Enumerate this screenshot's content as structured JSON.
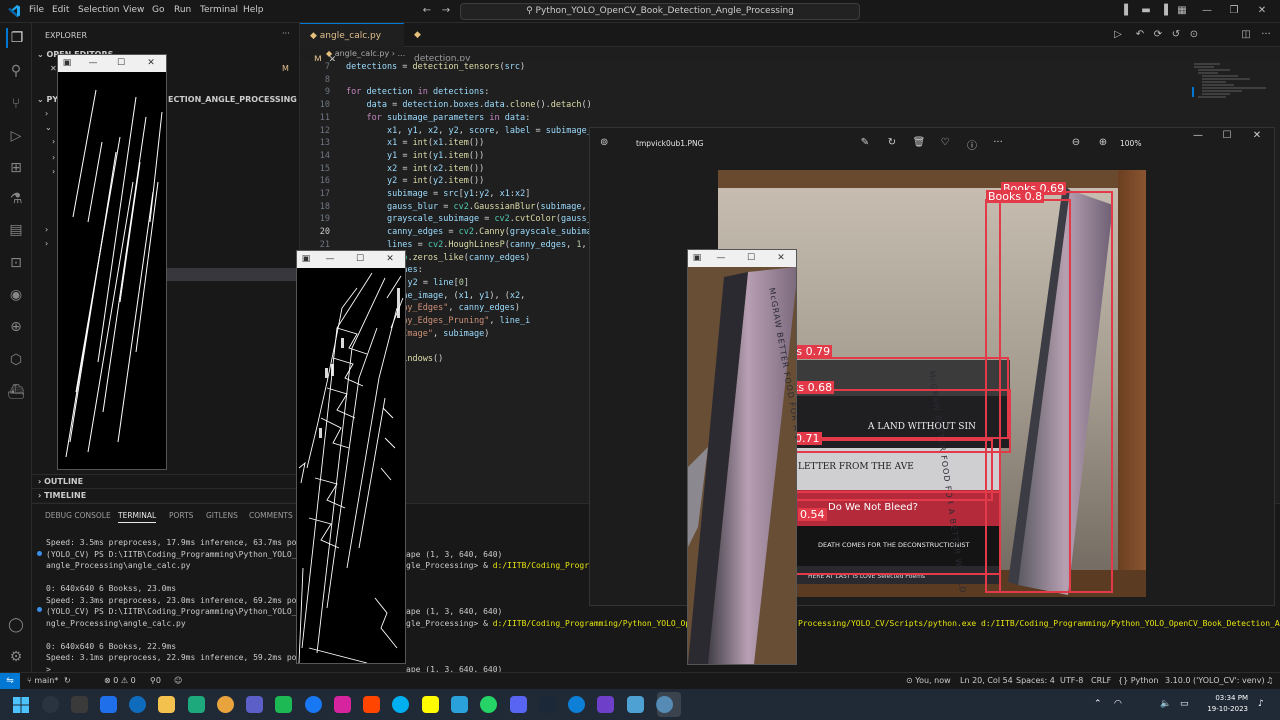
{
  "window": {
    "menu": [
      "File",
      "Edit",
      "Selection",
      "View",
      "Go",
      "Run",
      "Terminal",
      "Help"
    ],
    "search": "Python_YOLO_OpenCV_Book_Detection_Angle_Processing"
  },
  "sidebar": {
    "title": "EXPLORER",
    "open_editors": "OPEN EDITORS",
    "folder": "PYTHON_YOLO_OPENCV_BOOK_DETECTION_ANGLE_PROCESSING",
    "folder_visible": "ECTION_ANGLE_PROCESSING",
    "modified_marker": "M",
    "outline": "OUTLINE",
    "timeline": "TIMELINE"
  },
  "editor": {
    "tabs": [
      {
        "label": "angle_calc.py",
        "badge": "M"
      },
      {
        "label": "detection.py"
      }
    ],
    "breadcrumb": "angle_calc.py",
    "breadcrumb_more": "...",
    "current_line": 20
  },
  "code": [
    {
      "n": "7",
      "text": "detections = detection_tensors(src)"
    },
    {
      "n": "8",
      "text": ""
    },
    {
      "n": "9",
      "text": "for detection in detections:"
    },
    {
      "n": "10",
      "text": "    data = detection.boxes.data.clone().detach()"
    },
    {
      "n": "11",
      "text": "    for subimage_parameters in data:"
    },
    {
      "n": "12",
      "text": "        x1, y1, x2, y2, score, label = subimage_"
    },
    {
      "n": "13",
      "text": "        x1 = int(x1.item())"
    },
    {
      "n": "14",
      "text": "        y1 = int(y1.item())"
    },
    {
      "n": "15",
      "text": "        x2 = int(x2.item())"
    },
    {
      "n": "16",
      "text": "        y2 = int(y2.item())"
    },
    {
      "n": "17",
      "text": "        subimage = src[y1:y2, x1:x2]"
    },
    {
      "n": "18",
      "text": "        gauss_blur = cv2.GaussianBlur(subimage,"
    },
    {
      "n": "19",
      "text": "        grayscale_subimage = cv2.cvtColor(gauss_"
    },
    {
      "n": "20",
      "text": "        canny_edges = cv2.Canny(grayscale_subima"
    },
    {
      "n": "21",
      "text": "        lines = cv2.HoughLinesP(canny_edges, 1,"
    },
    {
      "n": "22",
      "text": "e_image = np.zeros_like(canny_edges)"
    },
    {
      "n": "23",
      "text": " line in lines:"
    },
    {
      "n": "24",
      "text": "x1, y1, x2, y2 = line[0]"
    },
    {
      "n": "25",
      "text": "cv2.line(line_image, (x1, y1), (x2,"
    },
    {
      "n": "26",
      "text": "imshow(\"Canny_Edges\", canny_edges)"
    },
    {
      "n": "27",
      "text": "imshow(\"Canny_Edges_Pruning\", line_i"
    },
    {
      "n": "28",
      "text": "imshow(\"SubImage\", subimage)"
    },
    {
      "n": "29",
      "text": "waitKey(0)"
    },
    {
      "n": "30",
      "text": "destroyAllWindows()"
    }
  ],
  "panel": {
    "tabs": [
      "DEBUG CONSOLE",
      "TERMINAL",
      "PORTS",
      "GITLENS",
      "COMMENTS"
    ],
    "active_tab": "TERMINAL",
    "lines": [
      "Speed: 3.5ms preprocess, 17.9ms inference, 63.7ms post",
      "(YOLO_CV) PS D:\\IITB\\Coding_Programming\\Python_YOLO_Op",
      "angle_Processing\\angle_calc.py",
      "",
      "0: 640x640 6 Bookss, 23.0ms",
      "Speed: 3.3ms preprocess, 23.0ms inference, 69.2ms post",
      "(YOLO_CV) PS D:\\IITB\\Coding_Programming\\Python_YOLO_Op",
      "ngle_Processing\\angle_calc.py",
      "",
      "0: 640x640 6 Bookss, 22.9ms",
      "Speed: 3.1ms preprocess, 22.9ms inference, 59.2ms post",
      ">"
    ],
    "right_lines": [
      {
        "row": 1,
        "text": "ape (1, 3, 640, 640)"
      },
      {
        "row": 2,
        "text": "gle_Processing> & d:/IITB/Coding_Program"
      },
      {
        "row": 6,
        "text": "ape (1, 3, 640, 640)"
      },
      {
        "row": 7,
        "text": "gle_Processing> & d:/IITB/Coding_Programming/Python_YOLO_OpenC"
      },
      {
        "row": 11,
        "text": "ape (1, 3, 640, 640)"
      }
    ],
    "right_tail": "Processing/YOLO_CV/Scripts/python.exe d:/IITB/Coding_Programming/Python_YOLO_OpenCV_Book_Detection_A"
  },
  "statusbar": {
    "branch": "main*",
    "sync": "↻",
    "problems": "⊗ 0 ⚠ 0",
    "blame": "You, now",
    "position": "Ln 20, Col 54",
    "spaces": "Spaces: 4",
    "encoding": "UTF-8",
    "eol": "CRLF",
    "language": "Python",
    "interpreter": "3.10.0 ('YOLO_CV': venv)"
  },
  "photo_viewer": {
    "filename": "tmpvick0ub1.PNG",
    "zoom": "100%",
    "detections": [
      "Books 0.69",
      "Books 0.8",
      "ks 0.79",
      "ks 0.68",
      "0.71",
      "0.54"
    ],
    "book_titles": [
      "A LAND WITHOUT SIN",
      "LETTER FROM THE AVE",
      "Do We Not Bleed?",
      "DEATH COMES FOR THE DECONSTRUCTIONIST",
      "HERE AT LAST IS LOVE   Selected Poems"
    ],
    "spine_text_right": "McGRAW  BETTER FOOD FOR A BETTER WORLD",
    "spine_text_left": "McGRAW  BETTER FOOD FOR A BETTER WORLD"
  },
  "taskbar": {
    "time": "03:34 PM",
    "date": "19-10-2023"
  },
  "colors": {
    "accent": "#0078d4",
    "detection_box": "#e23a48",
    "editor_bg": "#1f1f1f",
    "taskbar_bg": "#202a36"
  }
}
